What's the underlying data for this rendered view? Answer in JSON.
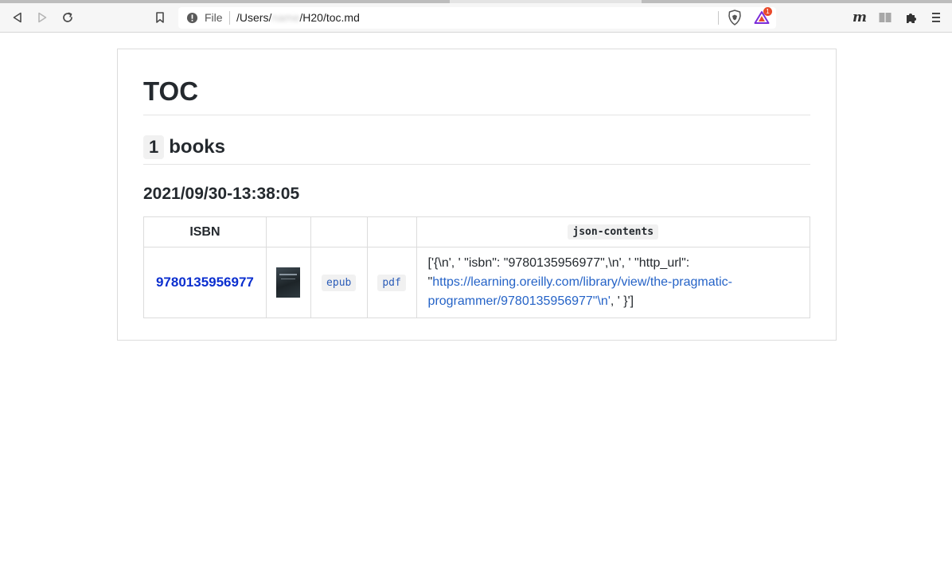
{
  "browser": {
    "url_scheme": "File",
    "url_prefix": "/Users/",
    "url_hidden": "name",
    "url_suffix": "/H20/toc.md",
    "brave_badge_count": "1",
    "ext_m_label": "m"
  },
  "page": {
    "title": "TOC",
    "section": {
      "number": "1",
      "label": "books"
    },
    "subsection": "2021/09/30-13:38:05",
    "table": {
      "headers": [
        "ISBN",
        "",
        "",
        "",
        "json-contents"
      ],
      "rows": [
        {
          "isbn": "9780135956977",
          "epub_label": "epub",
          "pdf_label": "pdf",
          "json_before_link": "['{\\n', ' \"isbn\": \"9780135956977\",\\n', ' \"http_url\": \"",
          "json_link": "https://learning.oreilly.com/library/view/the-pragmatic-programmer/9780135956977\"\\n'",
          "json_after_link": ", ' }']"
        }
      ]
    }
  },
  "colors": {
    "link": "#0b2fcf",
    "url_link": "#2563c7",
    "code_link": "#2b5cb8",
    "badge": "#e94a2b"
  }
}
